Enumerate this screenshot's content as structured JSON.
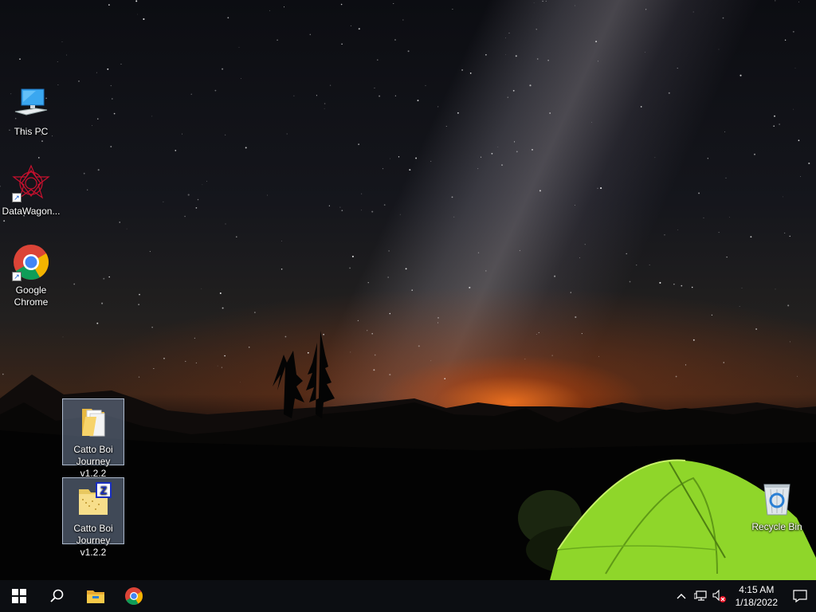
{
  "desktop": {
    "icons": [
      {
        "label": "This PC",
        "icon": "computer-icon"
      },
      {
        "label": "DataWagon...",
        "icon": "datawagon-icon"
      },
      {
        "label": "Google Chrome",
        "icon": "chrome-icon"
      },
      {
        "label": "Catto Boi Journey v1.2.2",
        "icon": "folder-icon"
      },
      {
        "label": "Catto Boi Journey v1.2.2",
        "icon": "zip-archive-icon"
      },
      {
        "label": "Recycle Bin",
        "icon": "recycle-bin-icon"
      }
    ]
  },
  "taskbar": {
    "start": "windows-logo-icon",
    "search": "search-icon",
    "pinned": [
      "file-explorer-icon",
      "chrome-icon"
    ],
    "tray": {
      "icons": [
        "chevron-up-icon",
        "network-icon",
        "volume-muted-icon"
      ],
      "time": "4:15 AM",
      "date": "1/18/2022",
      "notifications": "action-center-icon"
    }
  },
  "colors": {
    "taskbar_bg": "#0c0e12",
    "selection": "#8ca0be",
    "tent_green": "#8fd62a",
    "horizon_glow": "#ff7a1e"
  }
}
